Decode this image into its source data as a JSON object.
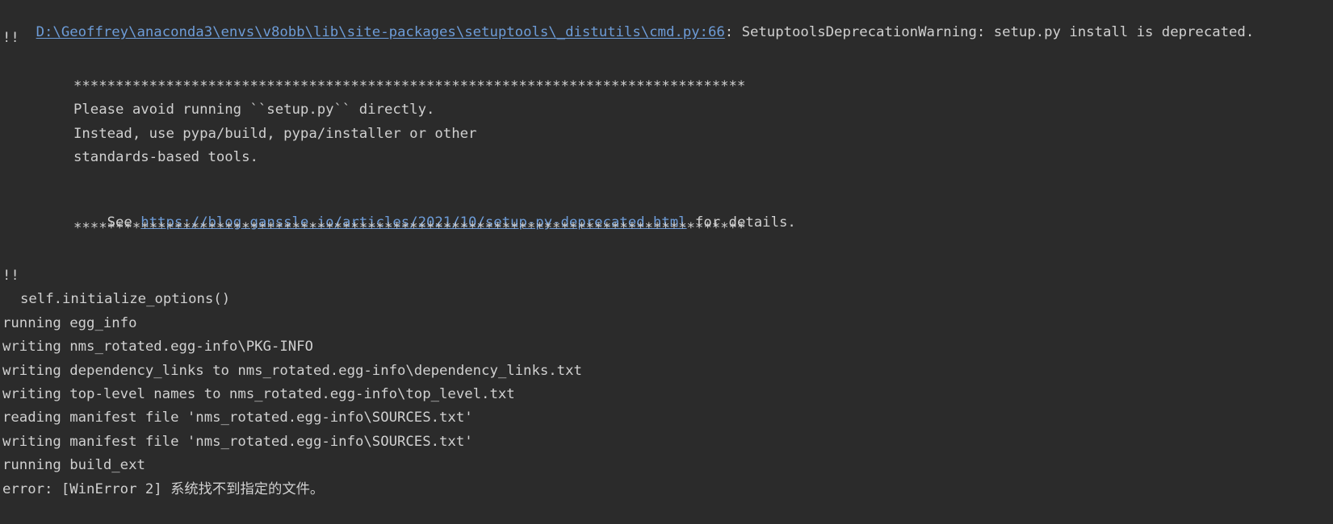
{
  "console": {
    "warning_path": "D:\\Geoffrey\\anaconda3\\envs\\v8obb\\lib\\site-packages\\setuptools\\_distutils\\cmd.py:66",
    "warning_message": ": SetuptoolsDeprecationWarning: setup.py install is deprecated.",
    "bang_line_1": "!!",
    "stars_top": "********************************************************************************",
    "notice_1": "Please avoid running ``setup.py`` directly.",
    "notice_2": "Instead, use pypa/build, pypa/installer or other",
    "notice_3": "standards-based tools.",
    "see_prefix": "See ",
    "see_url": "https://blog.ganssle.io/articles/2021/10/setup-py-deprecated.html",
    "see_suffix": " for details.",
    "stars_bottom": "********************************************************************************",
    "bang_line_2": "!!",
    "initialize": "self.initialize_options()",
    "lines": [
      "running egg_info",
      "writing nms_rotated.egg-info\\PKG-INFO",
      "writing dependency_links to nms_rotated.egg-info\\dependency_links.txt",
      "writing top-level names to nms_rotated.egg-info\\top_level.txt",
      "reading manifest file 'nms_rotated.egg-info\\SOURCES.txt'",
      "writing manifest file 'nms_rotated.egg-info\\SOURCES.txt'",
      "running build_ext",
      "error: [WinError 2] 系统找不到指定的文件。"
    ]
  }
}
